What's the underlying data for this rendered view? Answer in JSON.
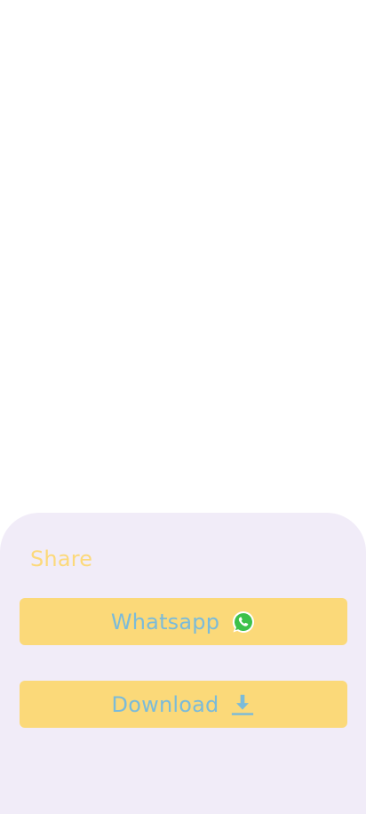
{
  "share_sheet": {
    "title": "Share",
    "whatsapp_button": {
      "label": "Whatsapp",
      "icon": "whatsapp-icon"
    },
    "download_button": {
      "label": "Download",
      "icon": "download-icon"
    }
  },
  "colors": {
    "sheet_background": "#f1ecf8",
    "title_text": "#fcd97a",
    "button_background": "#fbd979",
    "button_text": "#7bbbd9",
    "whatsapp_green": "#3cc14a"
  }
}
